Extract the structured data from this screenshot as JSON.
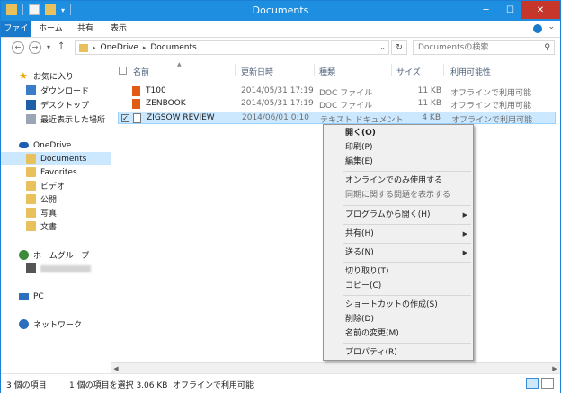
{
  "window": {
    "title": "Documents"
  },
  "ribbon": {
    "tabs": [
      "ファイル",
      "ホーム",
      "共有",
      "表示"
    ]
  },
  "address": {
    "breadcrumb": [
      "OneDrive",
      "Documents"
    ],
    "search_placeholder": "Documentsの検索"
  },
  "nav": {
    "favorites": "お気に入り",
    "downloads": "ダウンロード",
    "desktop": "デスクトップ",
    "recent": "最近表示した場所",
    "onedrive": "OneDrive",
    "folders": [
      "Documents",
      "Favorites",
      "ビデオ",
      "公開",
      "写真",
      "文書"
    ],
    "homegroup": "ホームグループ",
    "pc": "PC",
    "network": "ネットワーク"
  },
  "columns": {
    "name": "名前",
    "date": "更新日時",
    "type": "種類",
    "size": "サイズ",
    "availability": "利用可能性"
  },
  "files": [
    {
      "name": "T100",
      "date": "2014/05/31 17:19",
      "type": "DOC ファイル",
      "size": "11 KB",
      "availability": "オフラインで利用可能"
    },
    {
      "name": "ZENBOOK",
      "date": "2014/05/31 17:19",
      "type": "DOC ファイル",
      "size": "11 KB",
      "availability": "オフラインで利用可能"
    },
    {
      "name": "ZIGSOW REVIEW",
      "date": "2014/06/01 0:10",
      "type": "テキスト ドキュメント",
      "size": "4 KB",
      "availability": "オフラインで利用可能"
    }
  ],
  "context_menu": {
    "open": "開く(O)",
    "print": "印刷(P)",
    "edit": "編集(E)",
    "online_only": "オンラインでのみ使用する",
    "sync_problems": "同期に関する問題を表示する",
    "open_with": "プログラムから開く(H)",
    "share": "共有(H)",
    "send_to": "送る(N)",
    "cut": "切り取り(T)",
    "copy": "コピー(C)",
    "create_shortcut": "ショートカットの作成(S)",
    "delete": "削除(D)",
    "rename": "名前の変更(M)",
    "properties": "プロパティ(R)"
  },
  "status": {
    "item_count": "3 個の項目",
    "selected": "1 個の項目を選択 3.06 KB",
    "availability": "オフラインで利用可能"
  },
  "colors": {
    "accent": "#1e8fe0",
    "selection": "#cce8ff",
    "close": "#c7362b"
  }
}
